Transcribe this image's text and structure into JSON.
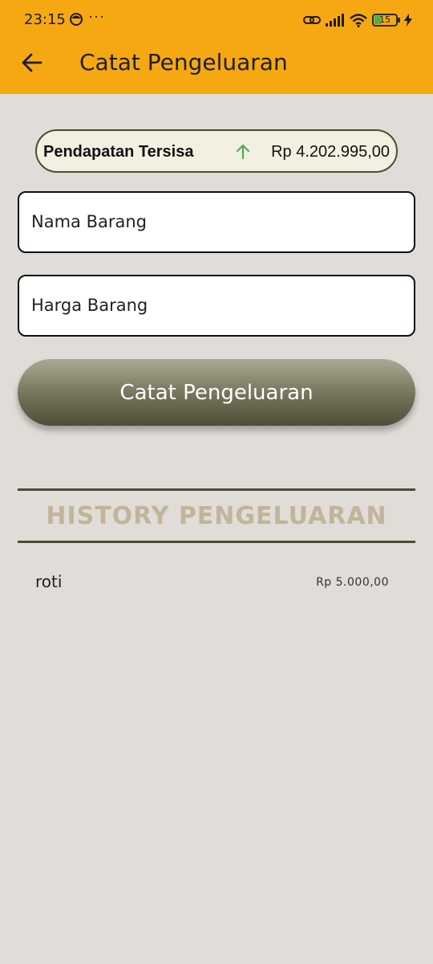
{
  "status_bar": {
    "time": "23:15",
    "more_indicator": "···",
    "battery_level": "15",
    "icons": [
      "emoji-icon",
      "link-icon",
      "signal-icon",
      "wifi-icon",
      "battery-icon",
      "charging-icon"
    ]
  },
  "app_bar": {
    "title": "Catat Pengeluaran",
    "back_icon": "arrow-left-icon",
    "color": "#f6a812"
  },
  "balance": {
    "label": "Pendapatan Tersisa",
    "value": "Rp 4.202.995,00",
    "trend_icon": "arrow-up-icon",
    "trend_color": "#4caf50"
  },
  "form": {
    "name_placeholder": "Nama Barang",
    "name_value": "",
    "price_placeholder": "Harga Barang",
    "price_value": "",
    "submit_label": "Catat Pengeluaran"
  },
  "history": {
    "title": "HISTORY PENGELUARAN",
    "items": [
      {
        "name": "roti",
        "price": "Rp 5.000,00"
      }
    ]
  },
  "colors": {
    "background": "#e0dcd7",
    "accent_dark": "#4f4a35",
    "history_title": "#c2b49a"
  }
}
